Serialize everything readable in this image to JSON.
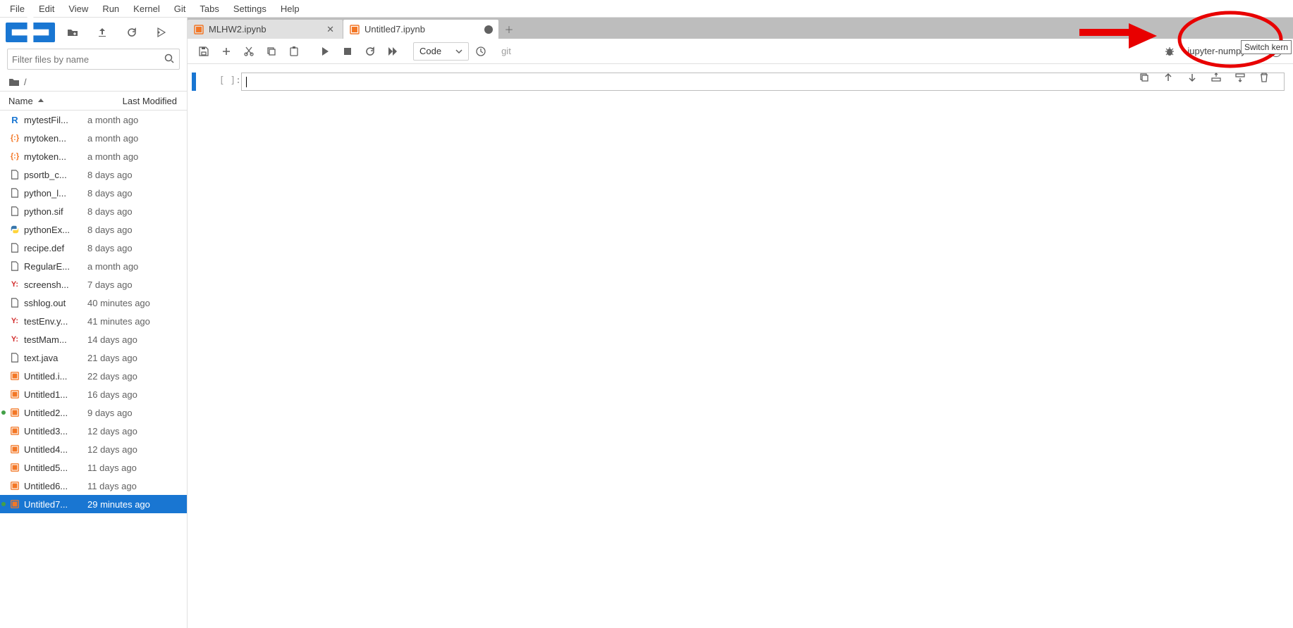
{
  "menu": [
    "File",
    "Edit",
    "View",
    "Run",
    "Kernel",
    "Git",
    "Tabs",
    "Settings",
    "Help"
  ],
  "filter": {
    "placeholder": "Filter files by name"
  },
  "breadcrumb": {
    "root": "/"
  },
  "columns": {
    "name": "Name",
    "modified": "Last Modified"
  },
  "files": [
    {
      "icon": "r",
      "name": "mytestFil...",
      "time": "a month ago"
    },
    {
      "icon": "json",
      "name": "mytoken...",
      "time": "a month ago"
    },
    {
      "icon": "json",
      "name": "mytoken...",
      "time": "a month ago"
    },
    {
      "icon": "file",
      "name": "psortb_c...",
      "time": "8 days ago"
    },
    {
      "icon": "file",
      "name": "python_l...",
      "time": "8 days ago"
    },
    {
      "icon": "file",
      "name": "python.sif",
      "time": "8 days ago"
    },
    {
      "icon": "py",
      "name": "pythonEx...",
      "time": "8 days ago"
    },
    {
      "icon": "file",
      "name": "recipe.def",
      "time": "8 days ago"
    },
    {
      "icon": "file",
      "name": "RegularE...",
      "time": "a month ago"
    },
    {
      "icon": "yml",
      "name": "screensh...",
      "time": "7 days ago"
    },
    {
      "icon": "file",
      "name": "sshlog.out",
      "time": "40 minutes ago"
    },
    {
      "icon": "yml",
      "name": "testEnv.y...",
      "time": "41 minutes ago"
    },
    {
      "icon": "yml",
      "name": "testMam...",
      "time": "14 days ago"
    },
    {
      "icon": "file",
      "name": "text.java",
      "time": "21 days ago"
    },
    {
      "icon": "nb",
      "name": "Untitled.i...",
      "time": "22 days ago"
    },
    {
      "icon": "nb",
      "name": "Untitled1...",
      "time": "16 days ago"
    },
    {
      "icon": "nb",
      "name": "Untitled2...",
      "time": "9 days ago",
      "running": true
    },
    {
      "icon": "nb",
      "name": "Untitled3...",
      "time": "12 days ago"
    },
    {
      "icon": "nb",
      "name": "Untitled4...",
      "time": "12 days ago"
    },
    {
      "icon": "nb",
      "name": "Untitled5...",
      "time": "11 days ago"
    },
    {
      "icon": "nb",
      "name": "Untitled6...",
      "time": "11 days ago"
    },
    {
      "icon": "nb",
      "name": "Untitled7...",
      "time": "29 minutes ago",
      "selected": true,
      "running": true
    }
  ],
  "tabs": [
    {
      "label": "MLHW2.ipynb",
      "active": false,
      "dirty": false
    },
    {
      "label": "Untitled7.ipynb",
      "active": true,
      "dirty": true
    }
  ],
  "toolbar": {
    "celltype": "Code",
    "git": "git",
    "kernel": "jupyter-numpy-env",
    "tooltip": "Switch kern"
  },
  "cell": {
    "prompt": "[ ]:"
  }
}
